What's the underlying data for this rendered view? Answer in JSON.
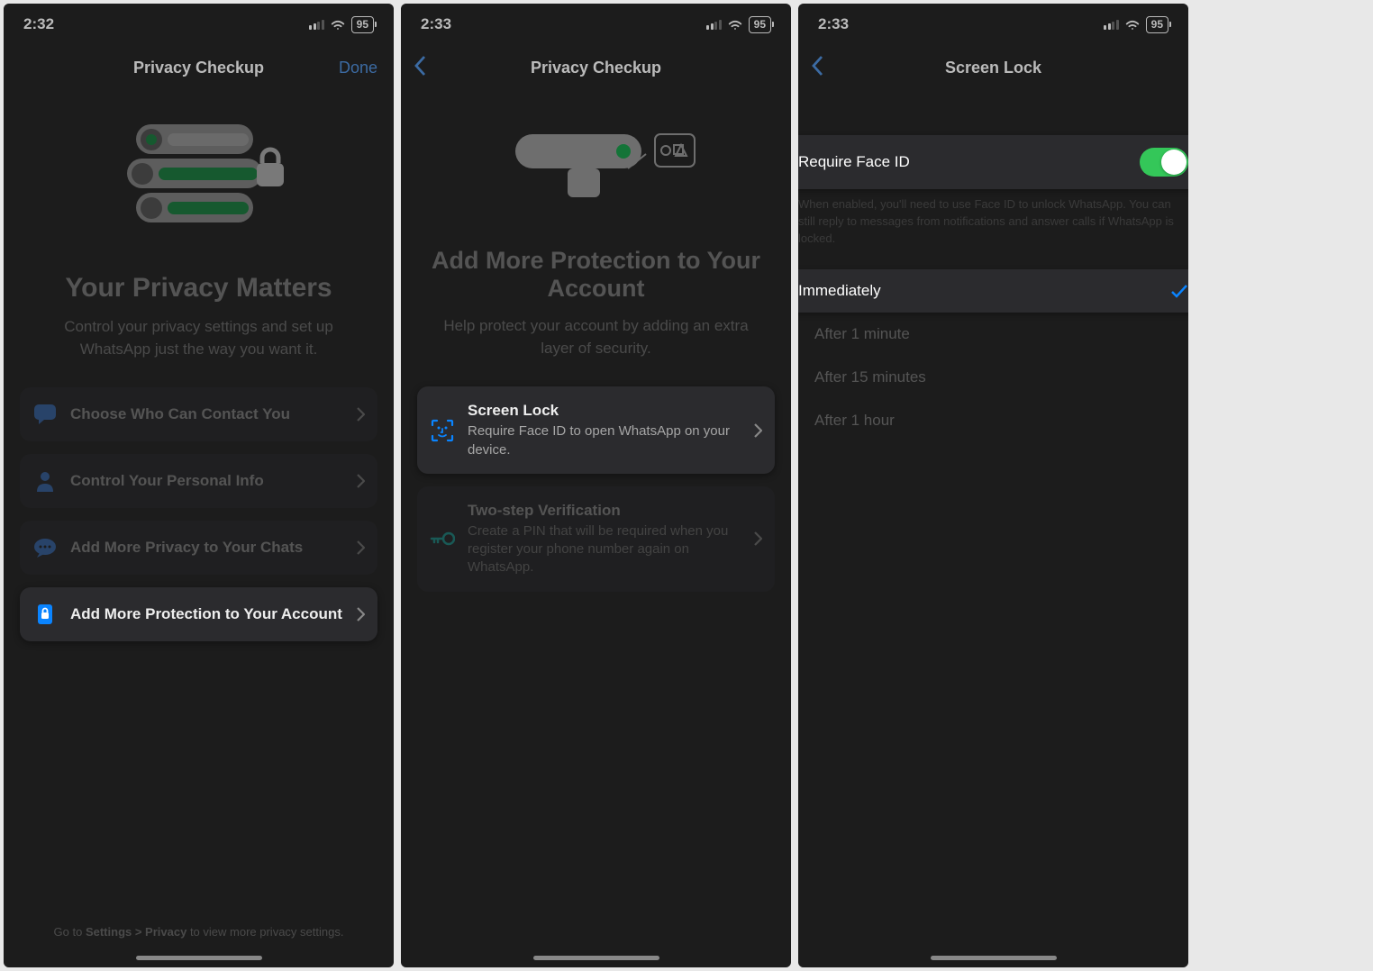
{
  "s1": {
    "time": "2:32",
    "battery": "95",
    "nav_title": "Privacy Checkup",
    "done": "Done",
    "hero_title": "Your Privacy Matters",
    "hero_sub": "Control your privacy settings and set up WhatsApp just the way you want it.",
    "rows": [
      {
        "title": "Choose Who Can Contact You"
      },
      {
        "title": "Control Your Personal Info"
      },
      {
        "title": "Add More Privacy to Your Chats"
      },
      {
        "title": "Add More Protection to Your Account"
      }
    ],
    "footer_pre": "Go to ",
    "footer_link": "Settings > Privacy",
    "footer_post": " to view more privacy settings."
  },
  "s2": {
    "time": "2:33",
    "battery": "95",
    "nav_title": "Privacy Checkup",
    "hero_title": "Add More Protection to Your Account",
    "hero_sub": "Help protect your account by adding an extra layer of security.",
    "rows": [
      {
        "title": "Screen Lock",
        "desc": "Require Face ID to open WhatsApp on your device."
      },
      {
        "title": "Two-step Verification",
        "desc": "Create a PIN that will be required when you register your phone number again on WhatsApp."
      }
    ]
  },
  "s3": {
    "time": "2:33",
    "battery": "95",
    "nav_title": "Screen Lock",
    "toggle_label": "Require Face ID",
    "toggle_hint": "When enabled, you'll need to use Face ID to unlock WhatsApp. You can still reply to messages from notifications and answer calls if WhatsApp is locked.",
    "options": [
      "Immediately",
      "After 1 minute",
      "After 15 minutes",
      "After 1 hour"
    ]
  }
}
